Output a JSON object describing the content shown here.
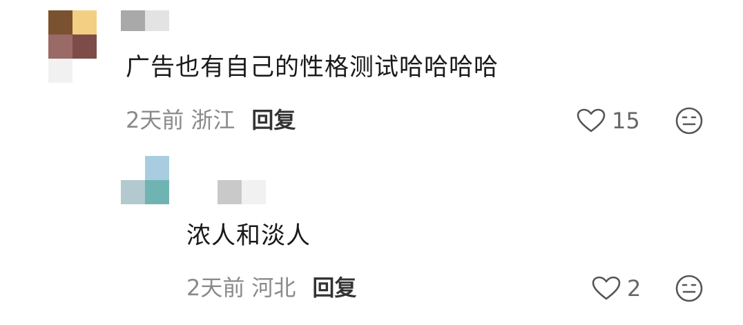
{
  "comments": [
    {
      "text": "广告也有自己的性格测试哈哈哈哈",
      "time": "2天前",
      "location": "浙江",
      "reply_label": "回复",
      "like_count": "15"
    },
    {
      "text": "浓人和淡人",
      "time": "2天前",
      "location": "河北",
      "reply_label": "回复",
      "like_count": "2"
    }
  ],
  "colors": {
    "text": "#1a1a1a",
    "meta": "#8a8a8a",
    "reply": "#333333",
    "icon": "#555555"
  },
  "icons": {
    "like": "heart-outline-icon",
    "dislike": "meh-face-icon"
  }
}
